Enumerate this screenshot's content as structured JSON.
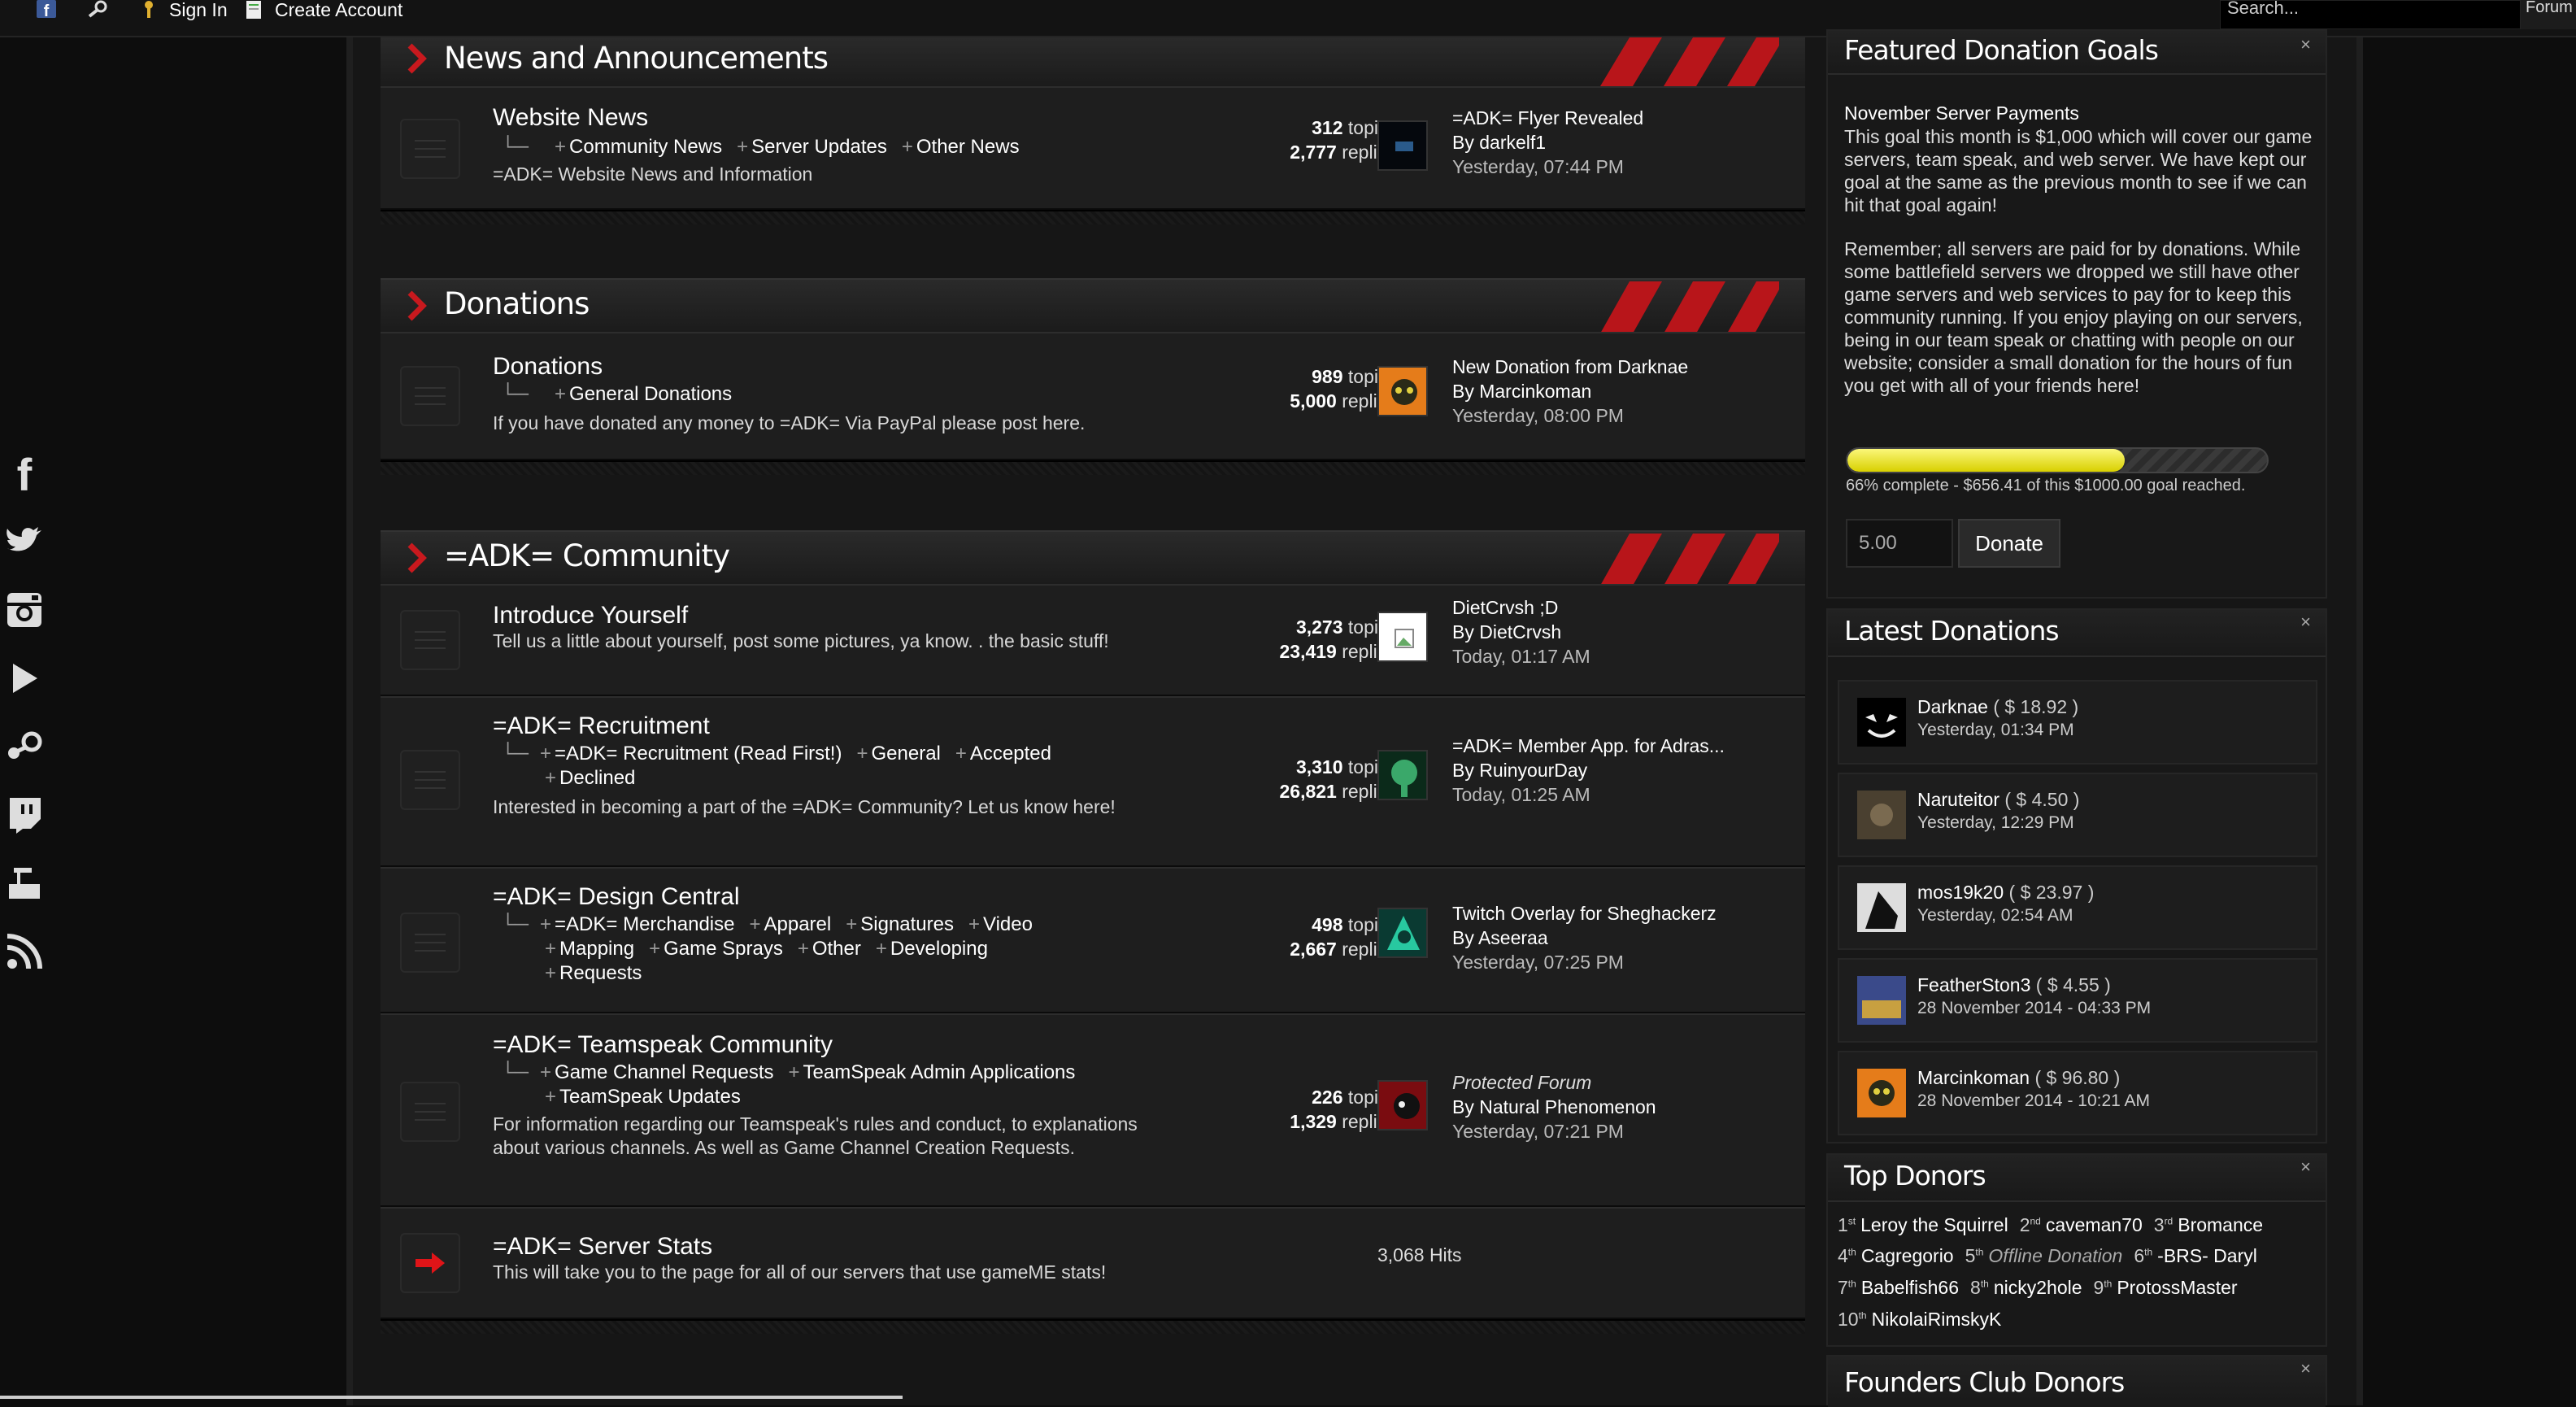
{
  "topbar": {
    "signin": "Sign In",
    "create": "Create Account",
    "search_placeholder": "Search...",
    "forum_tab": "Forum"
  },
  "sidebar": {
    "icons": [
      "facebook-icon",
      "twitter-icon",
      "instagram-icon",
      "youtube-icon",
      "steam-icon",
      "twitch-icon",
      "battlefield-icon",
      "rss-icon"
    ]
  },
  "categories": [
    {
      "title": "News and Announcements",
      "forums": [
        {
          "title": "Website News",
          "subforums": [
            "Community News",
            "Server Updates",
            "Other News"
          ],
          "description": "=ADK= Website News and Information",
          "topics": "312",
          "replies": "2,777",
          "last_title": "=ADK= Flyer Revealed",
          "last_by": "darkelf1",
          "last_date": "Yesterday, 07:44 PM"
        }
      ]
    },
    {
      "title": "Donations",
      "forums": [
        {
          "title": "Donations",
          "subforums": [
            "General Donations"
          ],
          "description": "If you have donated any money to =ADK= Via PayPal please post here.",
          "topics": "989",
          "replies": "5,000",
          "last_title": "New Donation from Darknae",
          "last_by": "Marcinkoman",
          "last_date": "Yesterday, 08:00 PM"
        }
      ]
    },
    {
      "title": "=ADK= Community",
      "forums": [
        {
          "title": "Introduce Yourself",
          "subforums": [],
          "description": "Tell us a little about yourself, post some pictures, ya know. . the basic stuff!",
          "topics": "3,273",
          "replies": "23,419",
          "last_title": "DietCrvsh ;D",
          "last_by": "DietCrvsh",
          "last_date": "Today, 01:17 AM"
        },
        {
          "title": "=ADK= Recruitment",
          "subforums": [
            "=ADK= Recruitment (Read First!)",
            "General",
            "Accepted",
            "Declined"
          ],
          "description": "Interested in becoming a part of the =ADK= Community? Let us know here!",
          "topics": "3,310",
          "replies": "26,821",
          "last_title": "=ADK= Member App. for Adras...",
          "last_by": "RuinyourDay",
          "last_date": "Today, 01:25 AM"
        },
        {
          "title": "=ADK= Design Central",
          "subforums": [
            "=ADK= Merchandise",
            "Apparel",
            "Signatures",
            "Video",
            "Mapping",
            "Game Sprays",
            "Other",
            "Developing",
            "Requests"
          ],
          "description": "",
          "topics": "498",
          "replies": "2,667",
          "last_title": "Twitch Overlay for Sheghackerz",
          "last_by": "Aseeraa",
          "last_date": "Yesterday, 07:25 PM"
        },
        {
          "title": "=ADK= Teamspeak Community",
          "subforums": [
            "Game Channel Requests",
            "TeamSpeak Admin Applications",
            "TeamSpeak Updates"
          ],
          "description": "For information regarding our Teamspeak's rules and conduct, to explanations about various channels. As well as Game Channel Creation Requests.",
          "topics": "226",
          "replies": "1,329",
          "last_title": "Protected Forum",
          "last_by": "Natural Phenomenon",
          "last_date": "Yesterday, 07:21 PM"
        },
        {
          "title": "=ADK= Server Stats",
          "description": "This will take you to the page for all of our servers that use gameME stats!",
          "hits": "3,068 Hits"
        }
      ]
    }
  ],
  "labels": {
    "topics": "topics",
    "replies": "replies",
    "by": "By"
  },
  "goals": {
    "title": "Featured Donation Goals",
    "name": "November Server Payments",
    "text1": "This goal this month is $1,000 which will cover our game servers, team speak, and web server. We have kept our goal at the same as the previous month to see if we can hit that goal again!",
    "text2": "Remember; all servers are paid for by donations. While some battlefield servers we dropped we still have other game servers and web services to pay for to keep this community running. If you enjoy playing on our servers, being in our team speak or chatting with people on our website; consider a small donation for the hours of fun you get with all of your friends here!",
    "progress": 0.66,
    "status": "66% complete - $656.41 of this $1000.00 goal reached.",
    "amount": "5.00",
    "donate": "Donate"
  },
  "latest": {
    "title": "Latest Donations",
    "items": [
      {
        "name": "Darknae",
        "amount": "( $ 18.92 )",
        "date": "Yesterday, 01:34 PM"
      },
      {
        "name": "Naruteitor",
        "amount": "( $ 4.50 )",
        "date": "Yesterday, 12:29 PM"
      },
      {
        "name": "mos19k20",
        "amount": "( $ 23.97 )",
        "date": "Yesterday, 02:54 AM"
      },
      {
        "name": "FeatherSton3",
        "amount": "( $ 4.55 )",
        "date": "28 November 2014 - 04:33 PM"
      },
      {
        "name": "Marcinkoman",
        "amount": "( $ 96.80 )",
        "date": "28 November 2014 - 10:21 AM"
      }
    ]
  },
  "topdonors": {
    "title": "Top Donors",
    "items": [
      {
        "rank": "1",
        "sup": "st",
        "name": "Leroy the Squirrel"
      },
      {
        "rank": "2",
        "sup": "nd",
        "name": "caveman70"
      },
      {
        "rank": "3",
        "sup": "rd",
        "name": "Bromance"
      },
      {
        "rank": "4",
        "sup": "th",
        "name": "Cagregorio"
      },
      {
        "rank": "5",
        "sup": "th",
        "name": "Offline Donation",
        "italic": true
      },
      {
        "rank": "6",
        "sup": "th",
        "name": "-BRS- Daryl"
      },
      {
        "rank": "7",
        "sup": "th",
        "name": "Babelfish66"
      },
      {
        "rank": "8",
        "sup": "th",
        "name": "nicky2hole"
      },
      {
        "rank": "9",
        "sup": "th",
        "name": "ProtossMaster"
      },
      {
        "rank": "10",
        "sup": "th",
        "name": "NikolaiRimskyK"
      }
    ]
  },
  "founders": {
    "title": "Founders Club Donors"
  },
  "close": "×",
  "colors": {
    "accent": "#c8191e",
    "progress": "#e6e000"
  }
}
